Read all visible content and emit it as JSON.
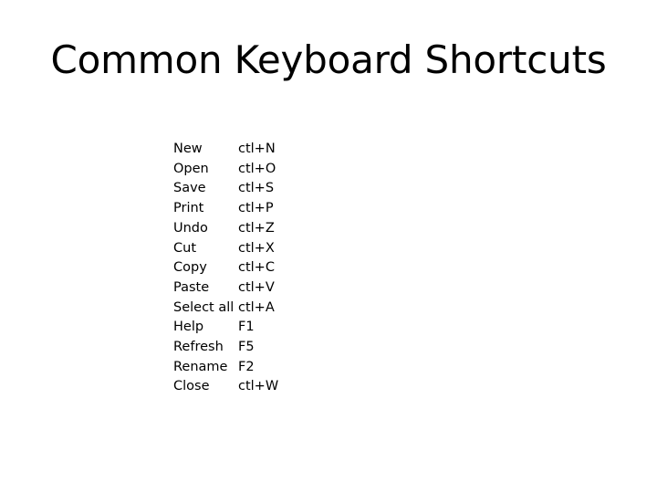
{
  "slide": {
    "title": "Common Keyboard Shortcuts",
    "background_color": "#ffffff",
    "text_color": "#000000"
  },
  "shortcuts": {
    "rows": [
      {
        "command": "New",
        "keys": "ctl+N"
      },
      {
        "command": "Open",
        "keys": "ctl+O"
      },
      {
        "command": "Save",
        "keys": "ctl+S"
      },
      {
        "command": "Print",
        "keys": "ctl+P"
      },
      {
        "command": "Undo",
        "keys": "ctl+Z"
      },
      {
        "command": "Cut",
        "keys": "ctl+X"
      },
      {
        "command": "Copy",
        "keys": "ctl+C"
      },
      {
        "command": "Paste",
        "keys": "ctl+V"
      },
      {
        "command": "Select all",
        "keys": "ctl+A"
      },
      {
        "command": "Help",
        "keys": "F1"
      },
      {
        "command": "Refresh",
        "keys": "F5"
      },
      {
        "command": "Rename",
        "keys": "F2"
      },
      {
        "command": "Close",
        "keys": "ctl+W"
      }
    ]
  }
}
